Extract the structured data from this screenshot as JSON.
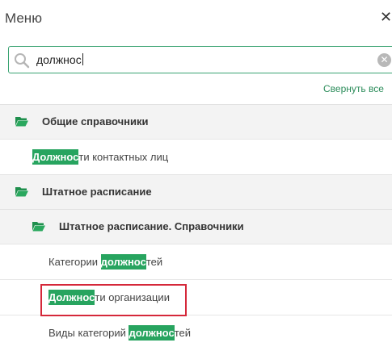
{
  "header": {
    "title": "Меню",
    "close_glyph": "✕"
  },
  "search": {
    "value": "должнос",
    "clear_glyph": "✕"
  },
  "collapse_label": "Свернуть все",
  "colors": {
    "accent": "#27a45f",
    "selection_border": "#d5283a"
  },
  "menu": {
    "group_general": {
      "label": "Общие справочники",
      "icon": "folder-open-icon"
    },
    "item_contact_positions": {
      "match": "Должнос",
      "rest": "ти контактных лиц"
    },
    "group_staffing": {
      "label": "Штатное расписание",
      "icon": "folder-open-icon"
    },
    "group_staffing_refs": {
      "label": "Штатное расписание. Справочники",
      "icon": "folder-open-icon"
    },
    "item_position_categories": {
      "before": "Категории ",
      "match": "должнос",
      "rest": "тей"
    },
    "item_org_positions": {
      "match": "Должнос",
      "rest": "ти организации"
    },
    "item_category_types": {
      "before": "Виды категорий ",
      "match": "должнос",
      "rest": "тей"
    }
  }
}
